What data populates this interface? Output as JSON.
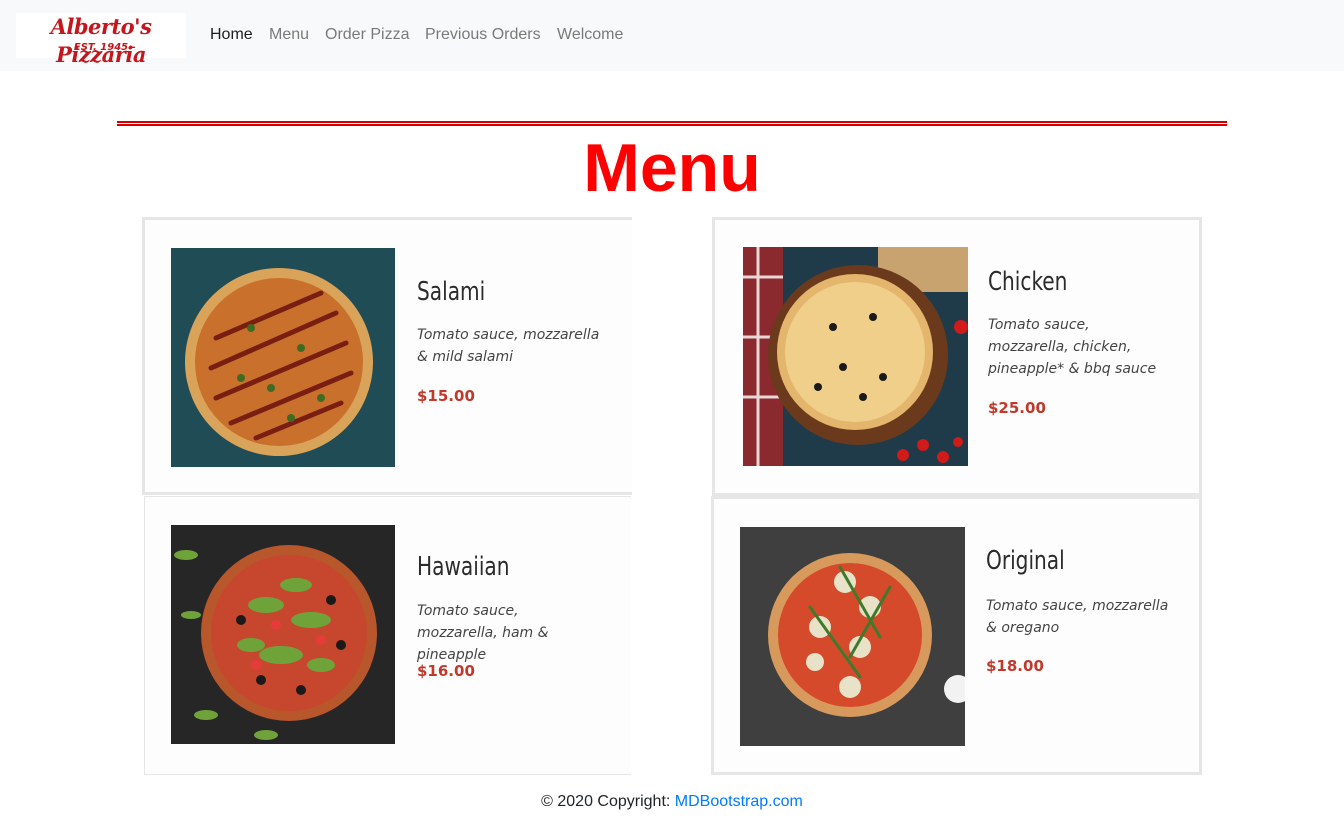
{
  "brand": {
    "name": "Alberto's Pizzaria",
    "tagline": "- EST. 1945 -"
  },
  "nav": {
    "items": [
      {
        "label": "Home",
        "active": true
      },
      {
        "label": "Menu",
        "active": false
      },
      {
        "label": "Order Pizza",
        "active": false
      },
      {
        "label": "Previous Orders",
        "active": false
      },
      {
        "label": "Welcome",
        "active": false
      }
    ]
  },
  "page": {
    "title": "Menu"
  },
  "menu": {
    "items": [
      {
        "name": "Salami",
        "description": "Tomato sauce, mozzarella & mild salami",
        "price": "$15.00"
      },
      {
        "name": "Chicken",
        "description": "Tomato sauce, mozzarella, chicken, pineapple* & bbq sauce",
        "price": "$25.00"
      },
      {
        "name": "Hawaiian",
        "description": "Tomato sauce, mozzarella, ham & pineapple",
        "price": "$16.00"
      },
      {
        "name": "Original",
        "description": "Tomato sauce, mozzarella & oregano",
        "price": "$18.00"
      }
    ]
  },
  "footer": {
    "copyright": "© 2020 Copyright:",
    "link_label": "MDBootstrap.com"
  },
  "colors": {
    "accent": "#ff0000",
    "link": "#007bff",
    "price": "#c0392b",
    "navbar_bg": "#f8f9fa"
  }
}
